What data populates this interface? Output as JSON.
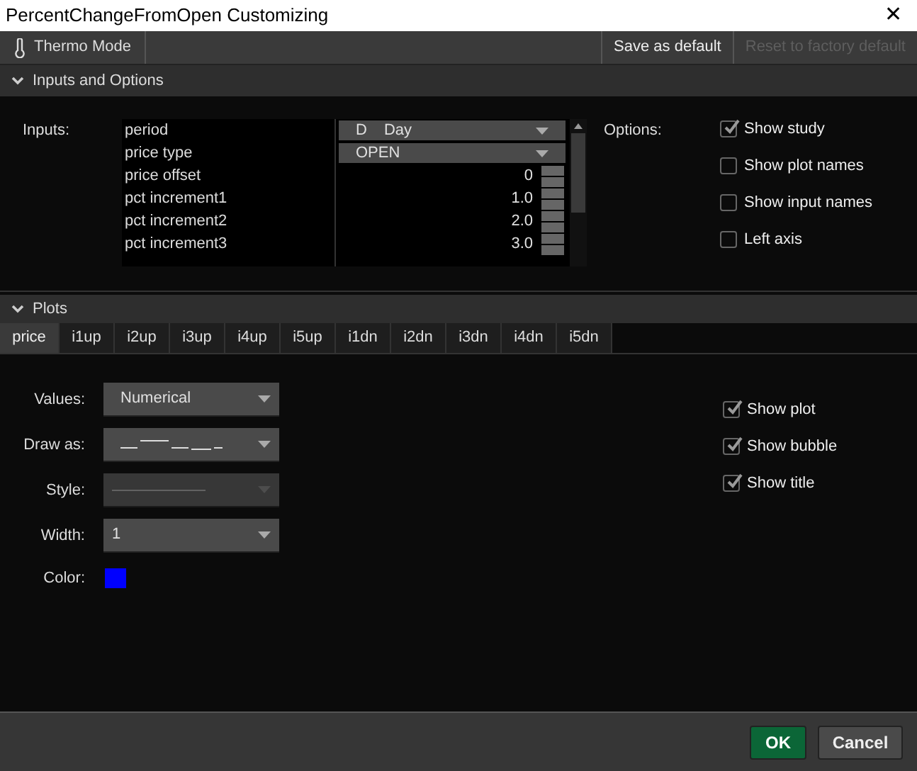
{
  "window": {
    "title": "PercentChangeFromOpen Customizing",
    "close": "✕"
  },
  "toolbar": {
    "thermo": "Thermo Mode",
    "save": "Save as default",
    "reset": {
      "label": "Reset to factory default",
      "disabled": true
    }
  },
  "inputs_section": {
    "title": "Inputs and Options",
    "expanded": true,
    "label": "Inputs:",
    "inputs": [
      {
        "name": "period",
        "kind": "dropdown",
        "prefix": "D",
        "value": "Day"
      },
      {
        "name": "price type",
        "kind": "dropdown",
        "value": "OPEN"
      },
      {
        "name": "price offset",
        "kind": "spinner",
        "value": "0"
      },
      {
        "name": "pct increment1",
        "kind": "spinner",
        "value": "1.0"
      },
      {
        "name": "pct increment2",
        "kind": "spinner",
        "value": "2.0"
      },
      {
        "name": "pct increment3",
        "kind": "spinner",
        "value": "3.0"
      }
    ],
    "options_label": "Options:",
    "options": [
      {
        "label": "Show study",
        "checked": true
      },
      {
        "label": "Show plot names",
        "checked": false
      },
      {
        "label": "Show input names",
        "checked": false
      },
      {
        "label": "Left axis",
        "checked": false
      }
    ]
  },
  "plots_section": {
    "title": "Plots",
    "expanded": true,
    "tabs": [
      {
        "label": "price",
        "selected": true
      },
      {
        "label": "i1up",
        "selected": false
      },
      {
        "label": "i2up",
        "selected": false
      },
      {
        "label": "i3up",
        "selected": false
      },
      {
        "label": "i4up",
        "selected": false
      },
      {
        "label": "i5up",
        "selected": false
      },
      {
        "label": "i1dn",
        "selected": false
      },
      {
        "label": "i2dn",
        "selected": false
      },
      {
        "label": "i3dn",
        "selected": false
      },
      {
        "label": "i4dn",
        "selected": false
      },
      {
        "label": "i5dn",
        "selected": false
      }
    ],
    "fields": [
      {
        "label": "Values:",
        "kind": "text",
        "value": "Numerical",
        "disabled": false
      },
      {
        "label": "Draw as:",
        "kind": "drawas",
        "disabled": false
      },
      {
        "label": "Style:",
        "kind": "style",
        "disabled": true
      },
      {
        "label": "Width:",
        "kind": "text",
        "value": "1",
        "disabled": false
      }
    ],
    "color_label": "Color:",
    "color": "#0000ff",
    "checks": [
      {
        "label": "Show plot",
        "checked": true
      },
      {
        "label": "Show bubble",
        "checked": true
      },
      {
        "label": "Show title",
        "checked": true
      }
    ]
  },
  "footer": {
    "ok": "OK",
    "cancel": "Cancel"
  }
}
